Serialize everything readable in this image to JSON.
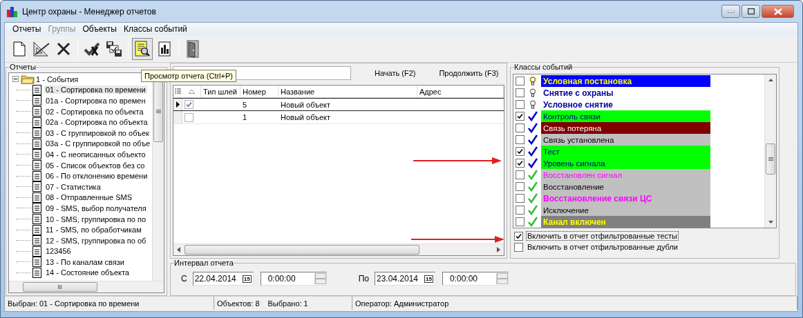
{
  "window": {
    "title": "Центр охраны - Менеджер отчетов"
  },
  "menu": [
    {
      "label": "Отчеты",
      "disabled": false
    },
    {
      "label": "Группы",
      "disabled": true
    },
    {
      "label": "Объекты",
      "disabled": false
    },
    {
      "label": "Классы событий",
      "disabled": false
    }
  ],
  "toolbar": [
    {
      "kind": "new",
      "pressed": false
    },
    {
      "kind": "edit",
      "pressed": false
    },
    {
      "kind": "delete",
      "pressed": false
    },
    {
      "kind": "separator"
    },
    {
      "kind": "check",
      "pressed": false
    },
    {
      "kind": "save",
      "pressed": false
    },
    {
      "kind": "separator"
    },
    {
      "kind": "preview",
      "pressed": true
    },
    {
      "kind": "chart",
      "pressed": false
    },
    {
      "kind": "separator"
    },
    {
      "kind": "exit",
      "pressed": false
    }
  ],
  "tooltip": "Просмотр отчета (Ctrl+P)",
  "reports": {
    "title": "Отчеты",
    "tree": [
      {
        "label": "1 - События",
        "expanded": true,
        "children": [
          {
            "label": "01 - Сортировка по времени",
            "selected": true
          },
          {
            "label": "01а - Сортировка по времен",
            "selected": false
          },
          {
            "label": "02 - Сортировка по объекта",
            "selected": false
          },
          {
            "label": "02а - Сортировка по объекта",
            "selected": false
          },
          {
            "label": "03 - С группировкой по объек",
            "selected": false
          },
          {
            "label": "03а - С группировкой по объе",
            "selected": false
          },
          {
            "label": "04 - С неописанных объекто",
            "selected": false
          },
          {
            "label": "05 - Список объектов без со",
            "selected": false
          },
          {
            "label": "06 - По отклонению времени",
            "selected": false
          },
          {
            "label": "07 - Статистика",
            "selected": false
          },
          {
            "label": "08 - Отправленные SMS",
            "selected": false
          },
          {
            "label": "09 - SMS, выбор получателя",
            "selected": false
          },
          {
            "label": "10 - SMS, группировка по по",
            "selected": false
          },
          {
            "label": "11 - SMS, по обработчикам",
            "selected": false
          },
          {
            "label": "12 - SMS, группировка по об",
            "selected": false
          },
          {
            "label": "123456",
            "selected": false
          },
          {
            "label": "13 - По каналам связи",
            "selected": false
          },
          {
            "label": "14 - Состояние объекта",
            "selected": false
          }
        ]
      }
    ]
  },
  "objects": {
    "buttons": [
      "Начать (F2)",
      "Продолжить (F3)"
    ],
    "columns": [
      "Тип шлей",
      "Номер",
      "Название",
      "Адрес"
    ],
    "rows": [
      {
        "current": true,
        "checked": true,
        "number": "5",
        "name": "Новый объект"
      },
      {
        "current": false,
        "checked": false,
        "number": "1",
        "name": "Новый объект"
      }
    ]
  },
  "event_classes": {
    "title": "Классы событий",
    "items": [
      {
        "kind": "bulb_lit",
        "checked": false,
        "color": "#0000ff",
        "label": {
          "text": "Условная постановка",
          "kind": "highlight",
          "bold": true
        }
      },
      {
        "kind": "bulb",
        "checked": false,
        "color": "#ffffff",
        "label": {
          "text": "Снятие с охраны",
          "kind": "arming",
          "bold": true
        }
      },
      {
        "kind": "bulb",
        "checked": false,
        "color": "#ffffff",
        "label": {
          "text": "Условное снятие",
          "kind": "arming",
          "bold": true
        }
      },
      {
        "kind": "check_blue",
        "checked": true,
        "color": "#00ff00",
        "label": {
          "text": "Контроль связи",
          "kind": "link",
          "bold": false
        }
      },
      {
        "kind": "check_blue",
        "checked": false,
        "color": "#800000",
        "label": {
          "text": "Связь потеряна",
          "kind": "alarm",
          "bold": false
        }
      },
      {
        "kind": "check_blue",
        "checked": false,
        "color": "#c0c0c0",
        "label": {
          "text": "Связь установлена",
          "kind": "plain",
          "bold": false
        }
      },
      {
        "kind": "check_blue",
        "checked": true,
        "color": "#00ff00",
        "label": {
          "text": "Тест",
          "kind": "link",
          "bold": false
        }
      },
      {
        "kind": "check_blue",
        "checked": true,
        "color": "#00ff00",
        "label": {
          "text": "Уровень сигнала",
          "kind": "link",
          "bold": false
        }
      },
      {
        "kind": "check_green",
        "checked": false,
        "color": "#c0c0c0",
        "label": {
          "text": "Восстановлен сигнал",
          "kind": "restore",
          "bold": false
        }
      },
      {
        "kind": "check_green",
        "checked": false,
        "color": "#c0c0c0",
        "label": {
          "text": "Восстановление",
          "kind": "plain",
          "bold": false
        }
      },
      {
        "kind": "check_green",
        "checked": false,
        "color": "#c0c0c0",
        "label": {
          "text": "Восстановление связи ЦС",
          "kind": "restore",
          "bold": true
        }
      },
      {
        "kind": "check_green",
        "checked": false,
        "color": "#c0c0c0",
        "label": {
          "text": "Исключение",
          "kind": "plain",
          "bold": false
        }
      },
      {
        "kind": "check_green",
        "checked": false,
        "color": "#808080",
        "label": {
          "text": "Канал включен",
          "kind": "highlight",
          "bold": true
        }
      }
    ],
    "options": [
      {
        "label": "Включить в отчет отфильтрованные тесты",
        "checked": true,
        "focused": true
      },
      {
        "label": "Включить в отчет отфильтрованные дубли",
        "checked": false,
        "focused": false
      }
    ]
  },
  "interval": {
    "title": "Интервал отчета",
    "from": {
      "label": "С",
      "date": "22.04.2014",
      "calendar": "15",
      "time": "0:00:00"
    },
    "to": {
      "label": "По",
      "date": "23.04.2014",
      "calendar": "15",
      "time": "0:00:00"
    }
  },
  "status_bar": [
    [
      "Выбран: 01 - Сортировка по времени"
    ],
    [
      "Объектов: 8",
      "Выбрано: 1"
    ],
    [
      "Оператор: Администратор"
    ]
  ]
}
